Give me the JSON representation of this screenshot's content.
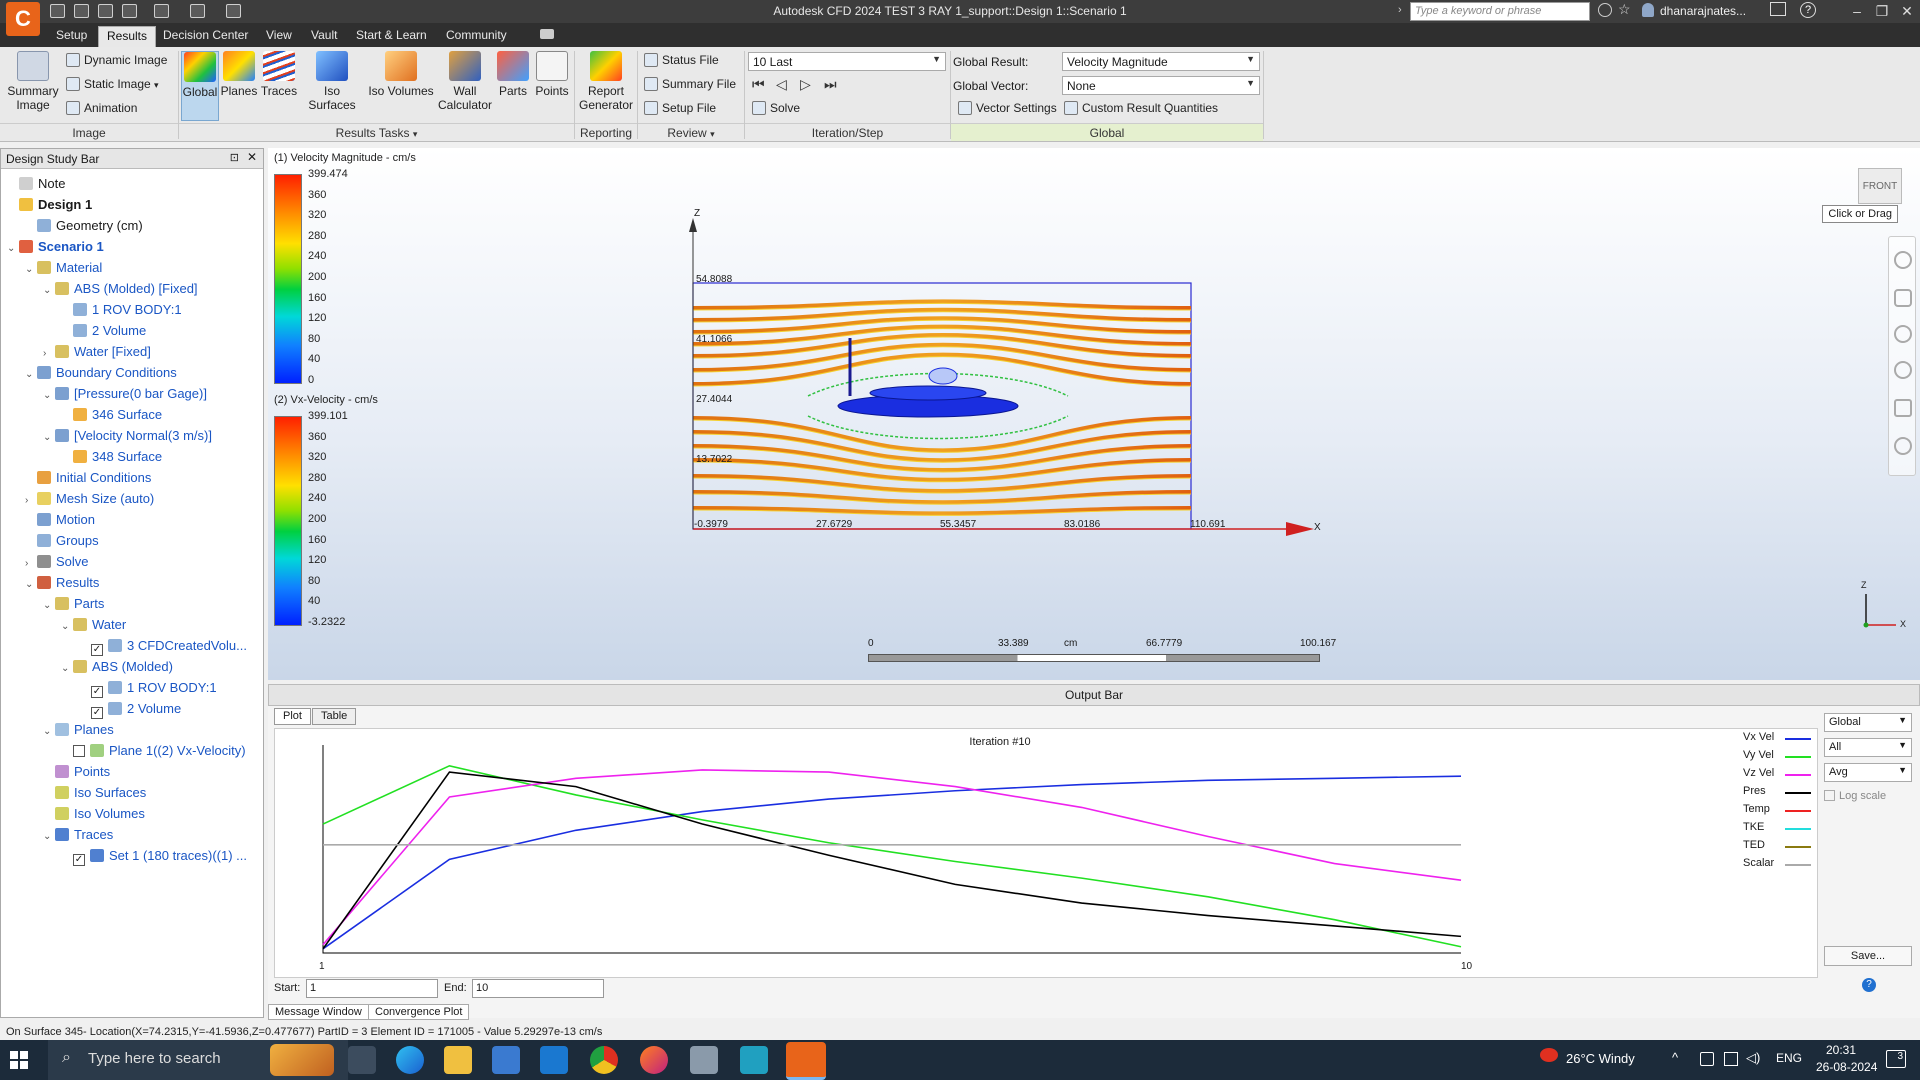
{
  "titlebar": {
    "title": "Autodesk CFD 2024   TEST 3 RAY 1_support::Design 1::Scenario 1",
    "search_placeholder": "Type a keyword or phrase",
    "user": "dhanarajnates...",
    "logo_letter": "C"
  },
  "ribbon_tabs": [
    "Setup",
    "Results",
    "Decision Center",
    "View",
    "Vault",
    "Start & Learn",
    "Community"
  ],
  "ribbon": {
    "image_panel": {
      "label": "Image",
      "summary_image": "Summary\nImage",
      "dynamic_image": "Dynamic Image",
      "static_image": "Static Image",
      "animation": "Animation"
    },
    "results_tasks_panel": {
      "label": "Results Tasks",
      "buttons": [
        "Global",
        "Planes",
        "Traces",
        "Iso Surfaces",
        "Iso Volumes",
        "Wall\nCalculator",
        "Parts",
        "Points"
      ]
    },
    "reporting_panel": {
      "label": "Reporting",
      "report_generator": "Report\nGenerator"
    },
    "review_panel": {
      "label": "Review",
      "status_file": "Status File",
      "summary_file": "Summary File",
      "setup_file": "Setup File"
    },
    "iteration_panel": {
      "label": "Iteration/Step",
      "step_value": "10 Last",
      "solve": "Solve"
    },
    "global_panel": {
      "label": "Global",
      "global_result_label": "Global Result:",
      "global_result_value": "Velocity Magnitude",
      "global_vector_label": "Global Vector:",
      "global_vector_value": "None",
      "vector_settings": "Vector Settings",
      "custom_result_quantities": "Custom Result Quantities"
    }
  },
  "design_study_bar": {
    "title": "Design Study Bar",
    "items": [
      {
        "label": "Note",
        "indent": 0,
        "expander": "",
        "icon": "note-icon",
        "color": "#cfcfcf",
        "style": ""
      },
      {
        "label": "Design 1",
        "indent": 0,
        "expander": "",
        "icon": "design-icon",
        "color": "#f0c040",
        "style": "bold"
      },
      {
        "label": "Geometry (cm)",
        "indent": 1,
        "expander": "",
        "icon": "geometry-icon",
        "color": "#8fb0d8",
        "style": ""
      },
      {
        "label": "Scenario 1",
        "indent": 0,
        "expander": "⌄",
        "icon": "scenario-icon",
        "color": "#e06040",
        "style": "bold blue"
      },
      {
        "label": "Material",
        "indent": 1,
        "expander": "⌄",
        "icon": "material-icon",
        "color": "#d8c060",
        "style": "blue"
      },
      {
        "label": "ABS (Molded) [Fixed]",
        "indent": 2,
        "expander": "⌄",
        "icon": "material-icon",
        "color": "#d8c060",
        "style": "blue"
      },
      {
        "label": "1 ROV BODY:1",
        "indent": 3,
        "expander": "",
        "icon": "part-icon",
        "color": "#8fb0d8",
        "style": "blue"
      },
      {
        "label": "2 Volume",
        "indent": 3,
        "expander": "",
        "icon": "part-icon",
        "color": "#8fb0d8",
        "style": "blue"
      },
      {
        "label": "Water [Fixed]",
        "indent": 2,
        "expander": "›",
        "icon": "material-icon",
        "color": "#d8c060",
        "style": "blue"
      },
      {
        "label": "Boundary Conditions",
        "indent": 1,
        "expander": "⌄",
        "icon": "bc-icon",
        "color": "#7ca0d0",
        "style": "blue"
      },
      {
        "label": "[Pressure(0 bar Gage)]",
        "indent": 2,
        "expander": "⌄",
        "icon": "bc-icon",
        "color": "#7ca0d0",
        "style": "blue"
      },
      {
        "label": "346 Surface",
        "indent": 3,
        "expander": "",
        "icon": "surface-icon",
        "color": "#f0b040",
        "style": "blue"
      },
      {
        "label": "[Velocity Normal(3 m/s)]",
        "indent": 2,
        "expander": "⌄",
        "icon": "bc-icon",
        "color": "#7ca0d0",
        "style": "blue"
      },
      {
        "label": "348 Surface",
        "indent": 3,
        "expander": "",
        "icon": "surface-icon",
        "color": "#f0b040",
        "style": "blue"
      },
      {
        "label": "Initial Conditions",
        "indent": 1,
        "expander": "",
        "icon": "ic-icon",
        "color": "#e8a040",
        "style": "blue"
      },
      {
        "label": "Mesh Size (auto)",
        "indent": 1,
        "expander": "›",
        "icon": "mesh-icon",
        "color": "#e8d060",
        "style": "blue"
      },
      {
        "label": "Motion",
        "indent": 1,
        "expander": "",
        "icon": "motion-icon",
        "color": "#7ca0d0",
        "style": "blue"
      },
      {
        "label": "Groups",
        "indent": 1,
        "expander": "",
        "icon": "groups-icon",
        "color": "#8fb0d8",
        "style": "blue"
      },
      {
        "label": "Solve",
        "indent": 1,
        "expander": "›",
        "icon": "solve-icon",
        "color": "#8f8f8f",
        "style": "blue"
      },
      {
        "label": "Results",
        "indent": 1,
        "expander": "⌄",
        "icon": "results-icon",
        "color": "#d06040",
        "style": "blue"
      },
      {
        "label": "Parts",
        "indent": 2,
        "expander": "⌄",
        "icon": "parts-icon",
        "color": "#d8c060",
        "style": "blue"
      },
      {
        "label": "Water",
        "indent": 3,
        "expander": "⌄",
        "icon": "material-icon",
        "color": "#d8c060",
        "style": "blue"
      },
      {
        "label": "3 CFDCreatedVolu...",
        "indent": 4,
        "expander": "",
        "icon": "part-icon",
        "color": "#8fb0d8",
        "style": "blue",
        "check": "✓"
      },
      {
        "label": "ABS (Molded)",
        "indent": 3,
        "expander": "⌄",
        "icon": "material-icon",
        "color": "#d8c060",
        "style": "blue"
      },
      {
        "label": "1 ROV BODY:1",
        "indent": 4,
        "expander": "",
        "icon": "part-icon",
        "color": "#8fb0d8",
        "style": "blue",
        "check": "✓"
      },
      {
        "label": "2 Volume",
        "indent": 4,
        "expander": "",
        "icon": "part-icon",
        "color": "#8fb0d8",
        "style": "blue",
        "check": "✓"
      },
      {
        "label": "Planes",
        "indent": 2,
        "expander": "⌄",
        "icon": "planes-icon",
        "color": "#a0c0e0",
        "style": "blue"
      },
      {
        "label": "Plane 1((2) Vx-Velocity)",
        "indent": 3,
        "expander": "",
        "icon": "plane-icon",
        "color": "#a0d080",
        "style": "blue",
        "check": " "
      },
      {
        "label": "Points",
        "indent": 2,
        "expander": "",
        "icon": "points-icon",
        "color": "#c090d0",
        "style": "blue"
      },
      {
        "label": "Iso Surfaces",
        "indent": 2,
        "expander": "",
        "icon": "iso-surface-icon",
        "color": "#d0d060",
        "style": "blue"
      },
      {
        "label": "Iso Volumes",
        "indent": 2,
        "expander": "",
        "icon": "iso-volume-icon",
        "color": "#d0d060",
        "style": "blue"
      },
      {
        "label": "Traces",
        "indent": 2,
        "expander": "⌄",
        "icon": "traces-icon",
        "color": "#5080d0",
        "style": "blue"
      },
      {
        "label": "Set 1 (180 traces)((1) ...",
        "indent": 3,
        "expander": "",
        "icon": "trace-set-icon",
        "color": "#5080d0",
        "style": "blue",
        "check": "✓"
      }
    ]
  },
  "viewport": {
    "legend1": {
      "title": "(1) Velocity Magnitude - cm/s",
      "ticks": [
        "399.474",
        "360",
        "320",
        "280",
        "240",
        "200",
        "160",
        "120",
        "80",
        "40",
        "0"
      ]
    },
    "legend2": {
      "title": "(2) Vx-Velocity - cm/s",
      "ticks": [
        "399.101",
        "360",
        "320",
        "280",
        "240",
        "200",
        "160",
        "120",
        "80",
        "40",
        "-3.2322"
      ]
    },
    "z_ticks": [
      "54.8088",
      "41.1066",
      "27.4044",
      "13.7022"
    ],
    "x_ticks": [
      "-0.3979",
      "27.6729",
      "55.3457",
      "83.0186",
      "110.691"
    ],
    "axis_x": "X",
    "axis_z": "Z",
    "scale": {
      "ticks": [
        "0",
        "33.389",
        "66.7779",
        "100.167"
      ],
      "unit": "cm"
    },
    "viewcube_label": "FRONT",
    "tooltip": "Click or Drag"
  },
  "output_bar": {
    "title": "Output Bar",
    "tabs": [
      "Plot",
      "Table"
    ],
    "plot_title": "Iteration #10",
    "x_start_label": "1",
    "x_end_label": "10",
    "legend": [
      {
        "name": "Vx Vel",
        "color": "#1a2ee0"
      },
      {
        "name": "Vy Vel",
        "color": "#22e022"
      },
      {
        "name": "Vz Vel",
        "color": "#ee22ee"
      },
      {
        "name": "Pres",
        "color": "#000000"
      },
      {
        "name": "Temp",
        "color": "#ee2222"
      },
      {
        "name": "TKE",
        "color": "#22dddd"
      },
      {
        "name": "TED",
        "color": "#8a7a10"
      },
      {
        "name": "Scalar",
        "color": "#aaaaaa"
      }
    ],
    "side": {
      "scope": "Global",
      "filter": "All",
      "mode": "Avg",
      "log_scale": "Log scale",
      "save": "Save..."
    },
    "start_label": "Start:",
    "start_value": "1",
    "end_label": "End:",
    "end_value": "10",
    "bottom_tabs": [
      "Message Window",
      "Convergence Plot"
    ]
  },
  "chart_data": {
    "type": "line",
    "title": "Iteration #10",
    "xlabel": "",
    "ylabel": "",
    "x": [
      1,
      2,
      3,
      4,
      5,
      6,
      7,
      8,
      9,
      10
    ],
    "series": [
      {
        "name": "Vx Vel",
        "color": "#1a2ee0",
        "values": [
          0.02,
          0.45,
          0.59,
          0.68,
          0.74,
          0.78,
          0.81,
          0.83,
          0.84,
          0.85
        ]
      },
      {
        "name": "Vy Vel",
        "color": "#22e022",
        "values": [
          0.62,
          0.9,
          0.76,
          0.64,
          0.53,
          0.44,
          0.36,
          0.27,
          0.16,
          0.03
        ]
      },
      {
        "name": "Vz Vel",
        "color": "#ee22ee",
        "values": [
          0.04,
          0.75,
          0.84,
          0.88,
          0.87,
          0.8,
          0.7,
          0.56,
          0.43,
          0.35
        ]
      },
      {
        "name": "Pres",
        "color": "#000000",
        "values": [
          0.02,
          0.87,
          0.8,
          0.62,
          0.47,
          0.33,
          0.24,
          0.18,
          0.13,
          0.08
        ]
      },
      {
        "name": "Scalar",
        "color": "#aaaaaa",
        "values": [
          0.52,
          0.52,
          0.52,
          0.52,
          0.52,
          0.52,
          0.52,
          0.52,
          0.52,
          0.52
        ]
      }
    ],
    "ylim": [
      0,
      1
    ]
  },
  "statusbar": "On Surface 345- Location(X=74.2315,Y=-41.5936,Z=0.477677) PartID = 3 Element ID = 171005 - Value 5.29297e-13  cm/s",
  "taskbar": {
    "search_placeholder": "Type here to search",
    "weather": "26°C  Windy",
    "language": "ENG",
    "time": "20:31",
    "date": "26-08-2024",
    "notification_count": "3"
  }
}
